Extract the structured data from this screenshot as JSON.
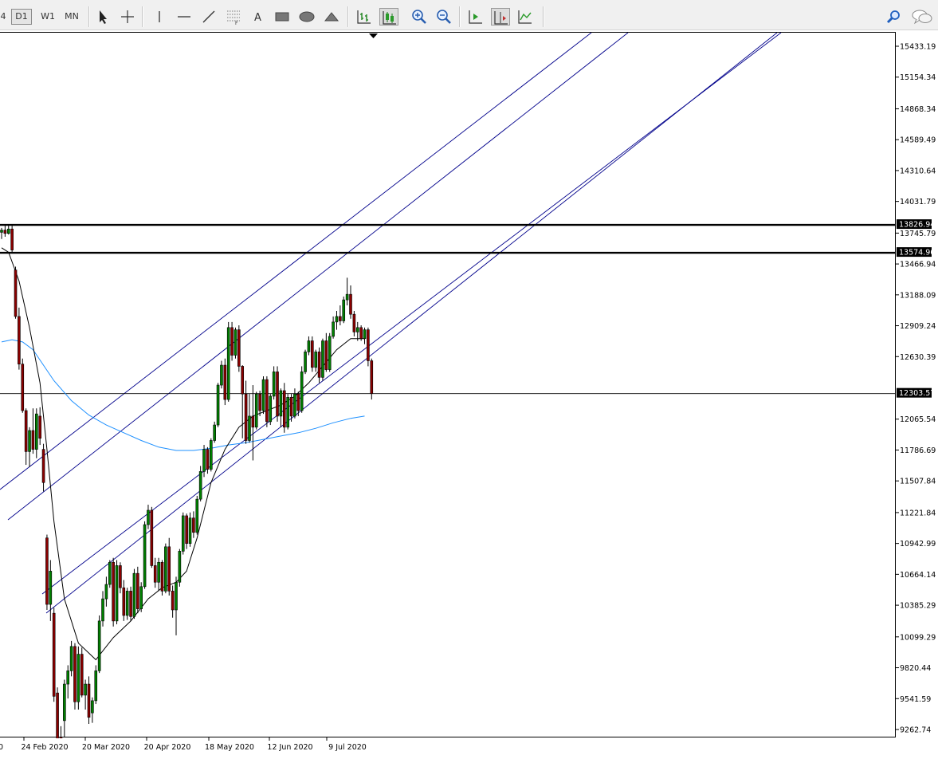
{
  "toolbar": {
    "timeframes": [
      "4",
      "D1",
      "W1",
      "MN"
    ],
    "active_timeframe": "D1",
    "tools": [
      "cursor-icon",
      "crosshair-icon",
      "vertical-line-icon",
      "horizontal-line-icon",
      "trendline-icon",
      "fibonacci-icon",
      "text-icon",
      "rectangle-icon",
      "ellipse-icon",
      "triangle-icon",
      "bar-chart-icon",
      "candlestick-icon",
      "zoom-in-icon",
      "zoom-out-icon",
      "autoscroll-icon",
      "chart-shift-icon",
      "indicators-icon",
      "search-icon",
      "chat-icon"
    ],
    "text_tool_label": "A"
  },
  "colors": {
    "bull": "#008000",
    "bear": "#8b0000",
    "ma_fast": "#000000",
    "ma_slow": "#1e90ff",
    "channel": "#00008b"
  },
  "chart_data": {
    "type": "candlestick",
    "y_axis_ticks": [
      "15433.19",
      "15154.34",
      "14868.34",
      "14589.49",
      "14310.64",
      "14031.79",
      "13745.79",
      "13466.94",
      "13188.09",
      "12909.24",
      "12630.39",
      "12065.54",
      "11786.69",
      "11507.84",
      "11221.84",
      "10942.99",
      "10664.14",
      "10385.29",
      "10099.29",
      "9820.44",
      "9541.59",
      "9262.74"
    ],
    "ylim": [
      9262.74,
      15433.19
    ],
    "x_axis_ticks": [
      "24 Feb 2020",
      "20 Mar 2020",
      "20 Apr 2020",
      "18 May 2020",
      "12 Jun 2020",
      "9 Jul 2020"
    ],
    "price_tags": [
      "13826.94",
      "13574.96",
      "12303.57"
    ],
    "horizontal_levels": [
      13826.94,
      13574.96,
      12303.57
    ],
    "candles": [
      {
        "o": 13760,
        "h": 13800,
        "l": 13700,
        "c": 13780
      },
      {
        "o": 13780,
        "h": 13826,
        "l": 13720,
        "c": 13750
      },
      {
        "o": 13750,
        "h": 13820,
        "l": 13740,
        "c": 13790
      },
      {
        "o": 13790,
        "h": 13826,
        "l": 13580,
        "c": 13600
      },
      {
        "o": 13420,
        "h": 13450,
        "l": 12980,
        "c": 13000
      },
      {
        "o": 13000,
        "h": 13080,
        "l": 12520,
        "c": 12570
      },
      {
        "o": 12570,
        "h": 12620,
        "l": 12130,
        "c": 12150
      },
      {
        "o": 12150,
        "h": 12170,
        "l": 11660,
        "c": 11780
      },
      {
        "o": 11780,
        "h": 12000,
        "l": 11640,
        "c": 11970
      },
      {
        "o": 11970,
        "h": 12170,
        "l": 11760,
        "c": 11800
      },
      {
        "o": 11800,
        "h": 12170,
        "l": 11720,
        "c": 12120
      },
      {
        "o": 12100,
        "h": 12180,
        "l": 11840,
        "c": 11900
      },
      {
        "o": 11800,
        "h": 11850,
        "l": 11420,
        "c": 11500
      },
      {
        "o": 11000,
        "h": 11030,
        "l": 10350,
        "c": 10400
      },
      {
        "o": 10400,
        "h": 10800,
        "l": 10250,
        "c": 10700
      },
      {
        "o": 10320,
        "h": 10370,
        "l": 9520,
        "c": 9570
      },
      {
        "o": 9600,
        "h": 9650,
        "l": 9100,
        "c": 9150
      },
      {
        "o": 9200,
        "h": 9300,
        "l": 9050,
        "c": 9100
      },
      {
        "o": 9350,
        "h": 9720,
        "l": 9200,
        "c": 9680
      },
      {
        "o": 9680,
        "h": 9850,
        "l": 9550,
        "c": 9800
      },
      {
        "o": 9800,
        "h": 10070,
        "l": 9750,
        "c": 10020
      },
      {
        "o": 10020,
        "h": 10050,
        "l": 9450,
        "c": 9520
      },
      {
        "o": 9520,
        "h": 10020,
        "l": 9450,
        "c": 9950
      },
      {
        "o": 9950,
        "h": 10010,
        "l": 9560,
        "c": 9580
      },
      {
        "o": 9580,
        "h": 9720,
        "l": 9450,
        "c": 9680
      },
      {
        "o": 9680,
        "h": 9750,
        "l": 9320,
        "c": 9380
      },
      {
        "o": 9420,
        "h": 9560,
        "l": 9330,
        "c": 9530
      },
      {
        "o": 9530,
        "h": 9850,
        "l": 9500,
        "c": 9800
      },
      {
        "o": 9800,
        "h": 10300,
        "l": 9780,
        "c": 10250
      },
      {
        "o": 10250,
        "h": 10520,
        "l": 10200,
        "c": 10450
      },
      {
        "o": 10450,
        "h": 10650,
        "l": 10380,
        "c": 10580
      },
      {
        "o": 10580,
        "h": 10800,
        "l": 10550,
        "c": 10780
      },
      {
        "o": 10780,
        "h": 10820,
        "l": 10200,
        "c": 10250
      },
      {
        "o": 10250,
        "h": 10800,
        "l": 10220,
        "c": 10750
      },
      {
        "o": 10750,
        "h": 10780,
        "l": 10500,
        "c": 10550
      },
      {
        "o": 10550,
        "h": 10620,
        "l": 10250,
        "c": 10300
      },
      {
        "o": 10300,
        "h": 10550,
        "l": 10260,
        "c": 10520
      },
      {
        "o": 10520,
        "h": 10560,
        "l": 10250,
        "c": 10290
      },
      {
        "o": 10290,
        "h": 10720,
        "l": 10270,
        "c": 10680
      },
      {
        "o": 10680,
        "h": 10740,
        "l": 10320,
        "c": 10360
      },
      {
        "o": 10360,
        "h": 10600,
        "l": 10330,
        "c": 10560
      },
      {
        "o": 10560,
        "h": 11150,
        "l": 10540,
        "c": 11120
      },
      {
        "o": 11120,
        "h": 11300,
        "l": 11080,
        "c": 11250
      },
      {
        "o": 11250,
        "h": 11280,
        "l": 10730,
        "c": 10750
      },
      {
        "o": 10750,
        "h": 10820,
        "l": 10550,
        "c": 10600
      },
      {
        "o": 10600,
        "h": 10820,
        "l": 10520,
        "c": 10780
      },
      {
        "o": 10780,
        "h": 10800,
        "l": 10480,
        "c": 10520
      },
      {
        "o": 10520,
        "h": 10950,
        "l": 10500,
        "c": 10920
      },
      {
        "o": 10920,
        "h": 11000,
        "l": 10480,
        "c": 10520
      },
      {
        "o": 10520,
        "h": 10570,
        "l": 10280,
        "c": 10350
      },
      {
        "o": 10350,
        "h": 10650,
        "l": 10120,
        "c": 10600
      },
      {
        "o": 10600,
        "h": 10900,
        "l": 10560,
        "c": 10880
      },
      {
        "o": 10880,
        "h": 11230,
        "l": 10850,
        "c": 11200
      },
      {
        "o": 11200,
        "h": 11220,
        "l": 10900,
        "c": 10950
      },
      {
        "o": 10950,
        "h": 11230,
        "l": 10920,
        "c": 11180
      },
      {
        "o": 11180,
        "h": 11240,
        "l": 11000,
        "c": 11050
      },
      {
        "o": 11050,
        "h": 11380,
        "l": 11030,
        "c": 11350
      },
      {
        "o": 11350,
        "h": 11650,
        "l": 11330,
        "c": 11600
      },
      {
        "o": 11600,
        "h": 11840,
        "l": 11550,
        "c": 11800
      },
      {
        "o": 11800,
        "h": 11820,
        "l": 11580,
        "c": 11620
      },
      {
        "o": 11620,
        "h": 11900,
        "l": 11600,
        "c": 11880
      },
      {
        "o": 11880,
        "h": 12050,
        "l": 11860,
        "c": 12020
      },
      {
        "o": 12020,
        "h": 12400,
        "l": 12000,
        "c": 12380
      },
      {
        "o": 12380,
        "h": 12600,
        "l": 12350,
        "c": 12560
      },
      {
        "o": 12560,
        "h": 12620,
        "l": 12200,
        "c": 12250
      },
      {
        "o": 12250,
        "h": 12950,
        "l": 12230,
        "c": 12900
      },
      {
        "o": 12900,
        "h": 12950,
        "l": 12600,
        "c": 12650
      },
      {
        "o": 12650,
        "h": 12900,
        "l": 12620,
        "c": 12880
      },
      {
        "o": 12880,
        "h": 12920,
        "l": 12500,
        "c": 12550
      },
      {
        "o": 12550,
        "h": 12560,
        "l": 11900,
        "c": 12300
      },
      {
        "o": 12300,
        "h": 12420,
        "l": 11850,
        "c": 11880
      },
      {
        "o": 11880,
        "h": 12300,
        "l": 11860,
        "c": 12100
      },
      {
        "o": 12100,
        "h": 12380,
        "l": 11700,
        "c": 12000
      },
      {
        "o": 12000,
        "h": 12320,
        "l": 11980,
        "c": 12300
      },
      {
        "o": 12300,
        "h": 12330,
        "l": 12100,
        "c": 12150
      },
      {
        "o": 12150,
        "h": 12460,
        "l": 12120,
        "c": 12430
      },
      {
        "o": 12430,
        "h": 12460,
        "l": 12000,
        "c": 12050
      },
      {
        "o": 12050,
        "h": 12300,
        "l": 12020,
        "c": 12280
      },
      {
        "o": 12280,
        "h": 12550,
        "l": 12250,
        "c": 12500
      },
      {
        "o": 12500,
        "h": 12550,
        "l": 12050,
        "c": 12100
      },
      {
        "o": 12100,
        "h": 12350,
        "l": 12000,
        "c": 12330
      },
      {
        "o": 12330,
        "h": 12400,
        "l": 11950,
        "c": 12000
      },
      {
        "o": 12000,
        "h": 12300,
        "l": 11980,
        "c": 12270
      },
      {
        "o": 12270,
        "h": 12300,
        "l": 12050,
        "c": 12100
      },
      {
        "o": 12100,
        "h": 12350,
        "l": 12080,
        "c": 12300
      },
      {
        "o": 12300,
        "h": 12320,
        "l": 12100,
        "c": 12150
      },
      {
        "o": 12150,
        "h": 12550,
        "l": 12130,
        "c": 12500
      },
      {
        "o": 12500,
        "h": 12700,
        "l": 12480,
        "c": 12680
      },
      {
        "o": 12680,
        "h": 12820,
        "l": 12650,
        "c": 12780
      },
      {
        "o": 12780,
        "h": 12820,
        "l": 12500,
        "c": 12540
      },
      {
        "o": 12540,
        "h": 12700,
        "l": 12500,
        "c": 12680
      },
      {
        "o": 12680,
        "h": 12720,
        "l": 12400,
        "c": 12450
      },
      {
        "o": 12450,
        "h": 12800,
        "l": 12420,
        "c": 12780
      },
      {
        "o": 12780,
        "h": 12850,
        "l": 12500,
        "c": 12520
      },
      {
        "o": 12520,
        "h": 12850,
        "l": 12500,
        "c": 12820
      },
      {
        "o": 12820,
        "h": 13000,
        "l": 12800,
        "c": 12950
      },
      {
        "o": 12950,
        "h": 13050,
        "l": 12880,
        "c": 13000
      },
      {
        "o": 13000,
        "h": 13100,
        "l": 12920,
        "c": 12960
      },
      {
        "o": 12960,
        "h": 13180,
        "l": 12940,
        "c": 13150
      },
      {
        "o": 13150,
        "h": 13350,
        "l": 13100,
        "c": 13200
      },
      {
        "o": 13200,
        "h": 13280,
        "l": 12980,
        "c": 13020
      },
      {
        "o": 13020,
        "h": 13050,
        "l": 12820,
        "c": 12860
      },
      {
        "o": 12860,
        "h": 12950,
        "l": 12780,
        "c": 12900
      },
      {
        "o": 12900,
        "h": 12920,
        "l": 12780,
        "c": 12800
      },
      {
        "o": 12800,
        "h": 12900,
        "l": 12750,
        "c": 12880
      },
      {
        "o": 12880,
        "h": 12900,
        "l": 12550,
        "c": 12600
      },
      {
        "o": 12600,
        "h": 12620,
        "l": 12250,
        "c": 12303
      }
    ],
    "ma_fast": [
      [
        0,
        13620
      ],
      [
        2,
        13580
      ],
      [
        5,
        13320
      ],
      [
        8,
        12900
      ],
      [
        11,
        12400
      ],
      [
        13,
        11800
      ],
      [
        15,
        11150
      ],
      [
        18,
        10450
      ],
      [
        22,
        10050
      ],
      [
        27,
        9900
      ],
      [
        32,
        10100
      ],
      [
        37,
        10250
      ],
      [
        42,
        10450
      ],
      [
        46,
        10550
      ],
      [
        50,
        10600
      ],
      [
        53,
        10700
      ],
      [
        56,
        11000
      ],
      [
        60,
        11500
      ],
      [
        64,
        11800
      ],
      [
        68,
        12000
      ],
      [
        72,
        12100
      ],
      [
        76,
        12150
      ],
      [
        80,
        12200
      ],
      [
        84,
        12280
      ],
      [
        88,
        12400
      ],
      [
        92,
        12550
      ],
      [
        96,
        12700
      ],
      [
        100,
        12800
      ],
      [
        104,
        12800
      ]
    ],
    "ma_slow": [
      [
        0,
        12770
      ],
      [
        3,
        12790
      ],
      [
        6,
        12770
      ],
      [
        9,
        12700
      ],
      [
        12,
        12560
      ],
      [
        15,
        12420
      ],
      [
        20,
        12240
      ],
      [
        25,
        12110
      ],
      [
        30,
        12020
      ],
      [
        35,
        11950
      ],
      [
        40,
        11880
      ],
      [
        45,
        11820
      ],
      [
        50,
        11790
      ],
      [
        55,
        11790
      ],
      [
        60,
        11810
      ],
      [
        65,
        11840
      ],
      [
        70,
        11860
      ],
      [
        75,
        11890
      ],
      [
        80,
        11920
      ],
      [
        85,
        11950
      ],
      [
        90,
        11990
      ],
      [
        95,
        12040
      ],
      [
        100,
        12080
      ],
      [
        104,
        12100
      ]
    ]
  }
}
